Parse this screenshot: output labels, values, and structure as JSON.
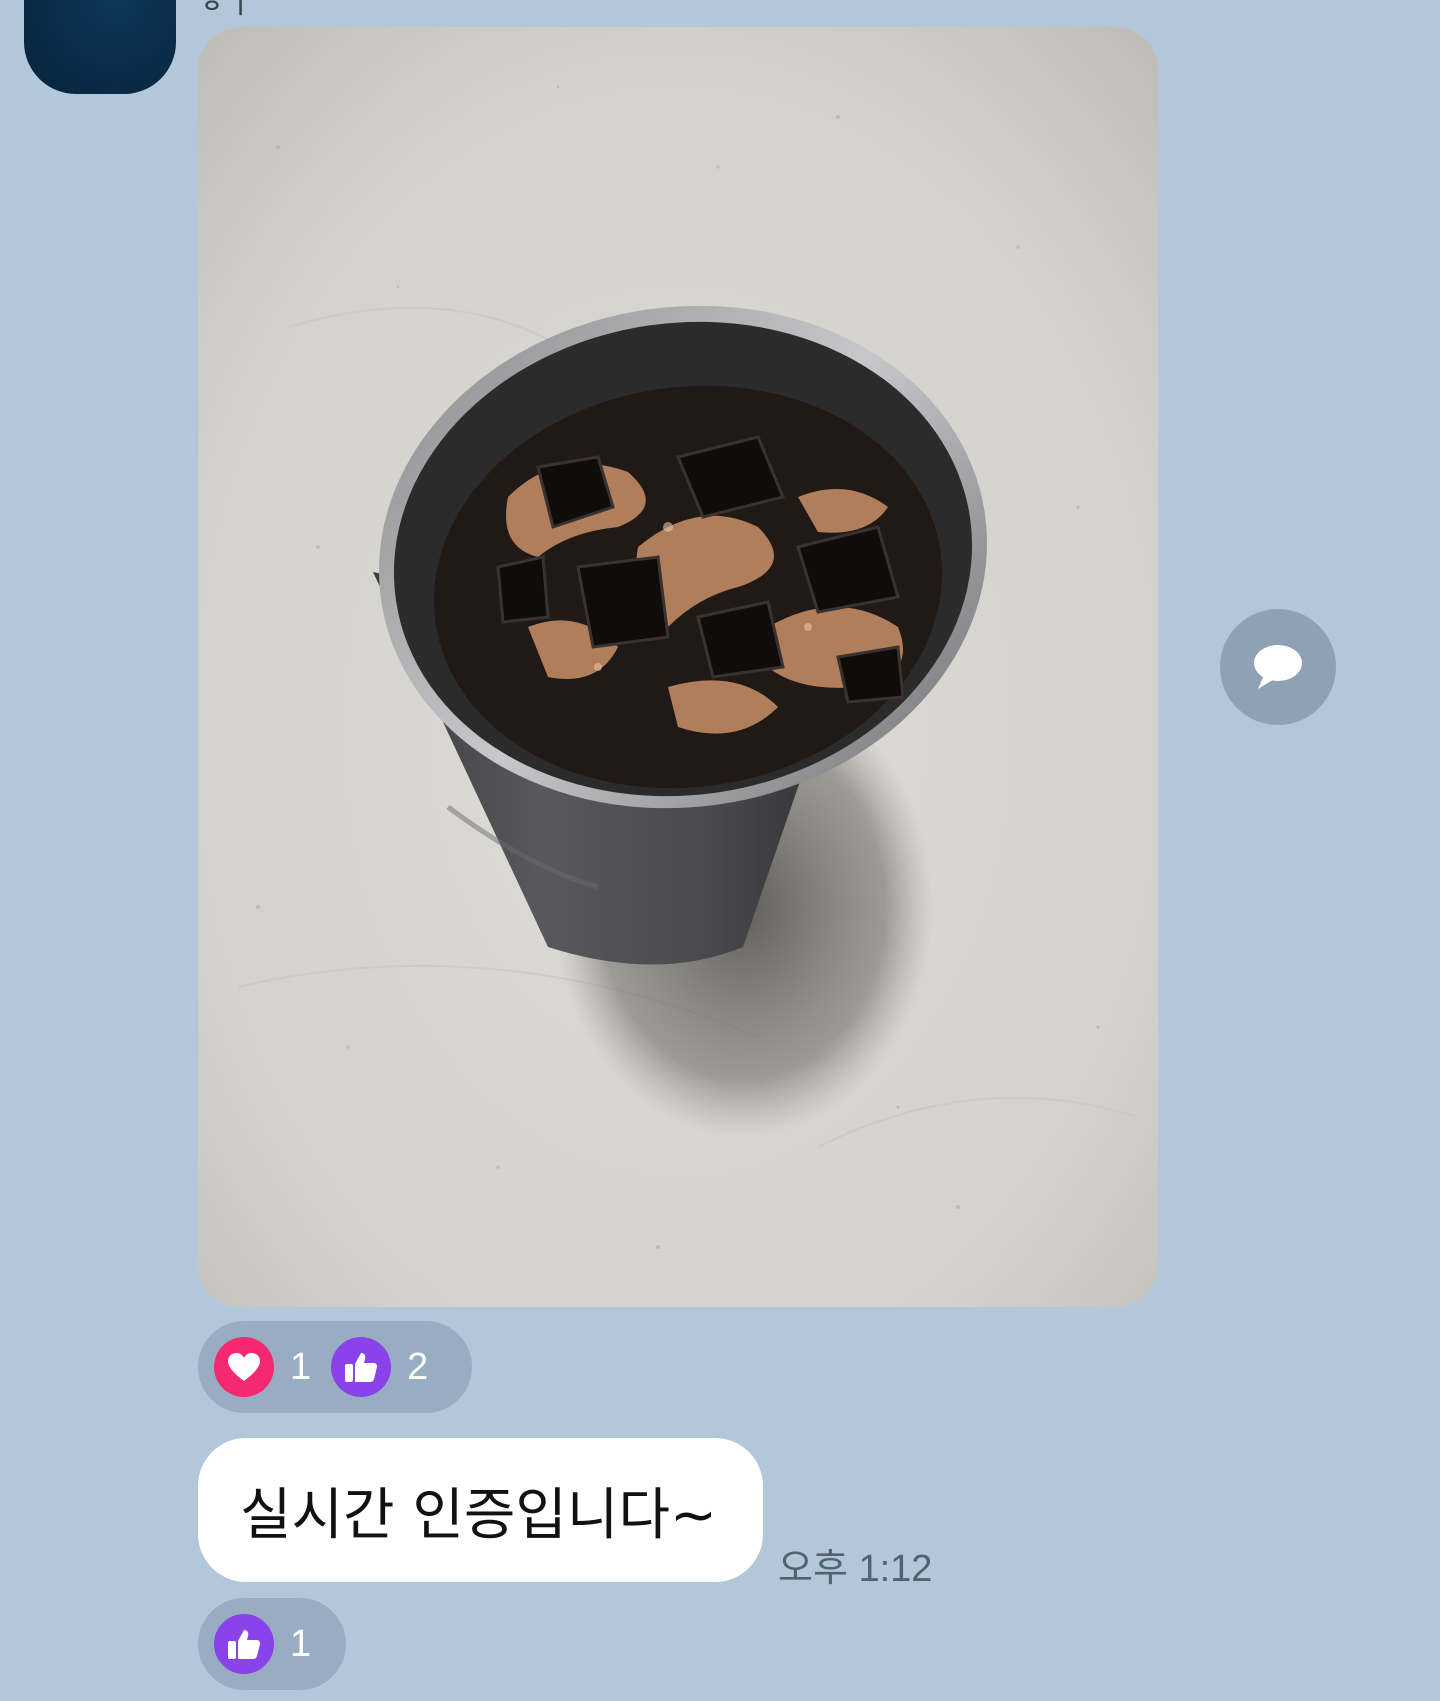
{
  "sender": {
    "name_partial": "ㅎㅣ"
  },
  "photo_message": {
    "image_alt": "iced coffee in dark stainless steel tumbler on stone counter",
    "reactions": [
      {
        "icon": "heart-icon",
        "color": "#f4296f",
        "count": "1"
      },
      {
        "icon": "thumbs-up-icon",
        "color": "#8a43e8",
        "count": "2"
      }
    ]
  },
  "share_button": {
    "icon": "speech-bubble-icon"
  },
  "text_message": {
    "text": "실시간 인증입니다~",
    "timestamp": "오후 1:12",
    "reactions": [
      {
        "icon": "thumbs-up-icon",
        "color": "#8a43e8",
        "count": "1"
      }
    ]
  },
  "colors": {
    "background": "#b2c7da",
    "bubble": "#ffffff",
    "reaction_pill": "#98adc1"
  }
}
